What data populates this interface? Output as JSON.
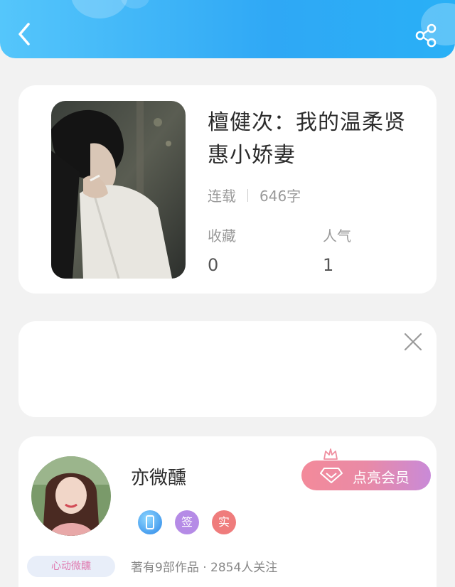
{
  "header": {
    "back_icon": "chevron-left-icon",
    "share_icon": "share-icon",
    "gradient": [
      "#55c6fb",
      "#2fa8f5"
    ]
  },
  "book": {
    "title": "檀健次：我的温柔贤惠小娇妻",
    "status": "连载",
    "word_count": "646字",
    "stats": [
      {
        "label": "收藏",
        "value": "0"
      },
      {
        "label": "人气",
        "value": "1"
      }
    ]
  },
  "empty_card": {
    "close_icon": "close-icon"
  },
  "author": {
    "name": "亦微醺",
    "vip_label": "点亮会员",
    "badges": [
      "签",
      "实"
    ],
    "tag": "心动微醺",
    "summary": "著有9部作品 · 2854人关注",
    "colors": {
      "vip_start": "#f38a9a",
      "vip_end": "#c98ad8"
    }
  }
}
